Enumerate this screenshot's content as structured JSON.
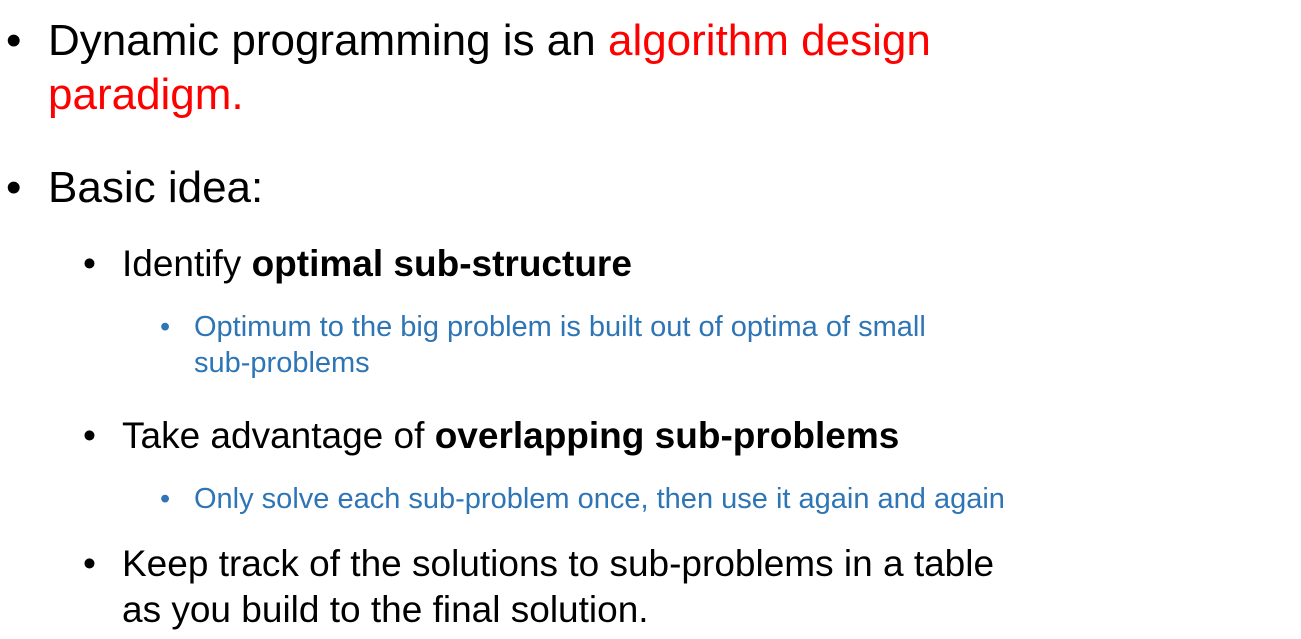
{
  "bullets": {
    "b1": {
      "prefix": "Dynamic programming is an ",
      "highlight_line1": "algorithm design",
      "highlight_line2": "paradigm."
    },
    "b2": {
      "text": "Basic idea:"
    },
    "b2_1": {
      "prefix": "Identify ",
      "bold": "optimal sub-structure"
    },
    "b2_1_1": {
      "line1": "Optimum to the big problem is built out of optima of small",
      "line2": "sub-problems"
    },
    "b2_2": {
      "prefix": "Take advantage of ",
      "bold": "overlapping sub-problems"
    },
    "b2_2_1": {
      "text": "Only solve each sub-problem once, then use it again and again"
    },
    "b2_3": {
      "line1": "Keep track of the solutions to sub-problems in a table",
      "line2": "as you build to the final solution."
    }
  },
  "colors": {
    "highlight": "#ff0000",
    "subnote": "#2e75b6",
    "text": "#000000"
  }
}
